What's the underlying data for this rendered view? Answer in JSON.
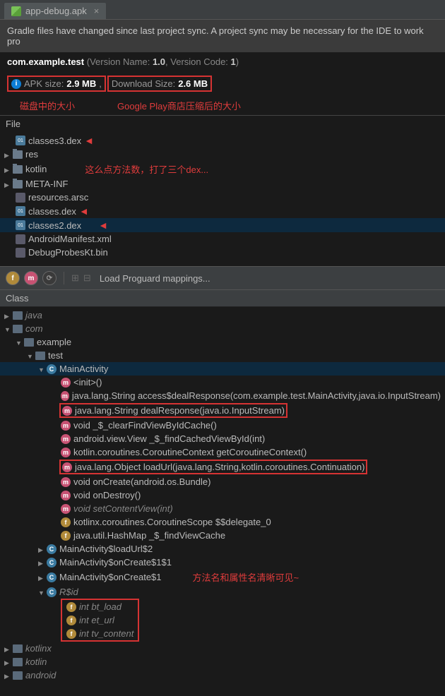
{
  "tab": {
    "title": "app-debug.apk"
  },
  "banner": "Gradle files have changed since last project sync. A project sync may be necessary for the IDE to work pro",
  "pkg": {
    "name": "com.example.test",
    "vname_label": "(Version Name:",
    "vname": "1.0",
    "vcode_label": ", Version Code:",
    "vcode": "1",
    "close": ")"
  },
  "size": {
    "apk_label": "APK size:",
    "apk_val": "2.9 MB",
    "sep": ",",
    "dl_label": "Download Size:",
    "dl_val": "2.6 MB"
  },
  "annot1": "磁盘中的大小",
  "annot2": "Google Play商店压缩后的大小",
  "file_header": "File",
  "files": {
    "classes3": "classes3.dex",
    "res": "res",
    "kotlin": "kotlin",
    "metainf": "META-INF",
    "resources": "resources.arsc",
    "classes": "classes.dex",
    "classes2": "classes2.dex",
    "manifest": "AndroidManifest.xml",
    "debug": "DebugProbesKt.bin"
  },
  "annot3": "这么点方法数，打了三个dex...",
  "toolbar": {
    "load": "Load Proguard mappings..."
  },
  "class_header": "Class",
  "tree": {
    "java": "java",
    "com": "com",
    "example": "example",
    "test": "test",
    "main": "MainActivity",
    "m0": "<init>()",
    "m1": "java.lang.String access$dealResponse(com.example.test.MainActivity,java.io.InputStream)",
    "m2": "java.lang.String dealResponse(java.io.InputStream)",
    "m3": "void _$_clearFindViewByIdCache()",
    "m4": "android.view.View _$_findCachedViewById(int)",
    "m5": "kotlin.coroutines.CoroutineContext getCoroutineContext()",
    "m6": "java.lang.Object loadUrl(java.lang.String,kotlin.coroutines.Continuation)",
    "m7": "void onCreate(android.os.Bundle)",
    "m8": "void onDestroy()",
    "m9": "void setContentView(int)",
    "f0": "kotlinx.coroutines.CoroutineScope $$delegate_0",
    "f1": "java.util.HashMap _$_findViewCache",
    "c1": "MainActivity$loadUrl$2",
    "c2": "MainActivity$onCreate$1$1",
    "c3": "MainActivity$onCreate$1",
    "rid": "R$id",
    "rid0": "int bt_load",
    "rid1": "int et_url",
    "rid2": "int tv_content",
    "kotlinx": "kotlinx",
    "kotlin2": "kotlin",
    "android": "android"
  },
  "annot4": "方法名和属性名清晰可见~"
}
